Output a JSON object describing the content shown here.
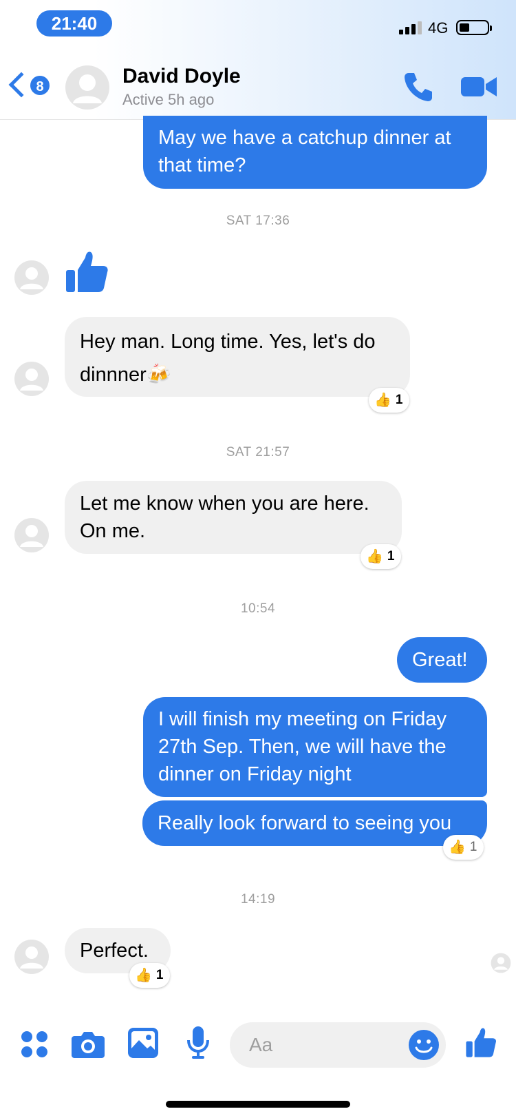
{
  "status_bar": {
    "time": "21:40",
    "network": "4G",
    "battery_percent": 30
  },
  "header": {
    "back_badge": "8",
    "contact_name": "David Doyle",
    "contact_status": "Active 5h ago",
    "icons": [
      "chevron-left-icon",
      "phone-icon",
      "video-camera-icon"
    ]
  },
  "messages": [
    {
      "dir": "out",
      "text": "May we have a catchup dinner at that time?"
    },
    {
      "timestamp": "SAT 17:36"
    },
    {
      "dir": "in",
      "type": "thumbs-up-sticker"
    },
    {
      "dir": "in",
      "text": "Hey man. Long time. Yes, let's do dinnner🍻",
      "reaction": {
        "emoji": "👍",
        "count": "1"
      }
    },
    {
      "timestamp": "SAT 21:57"
    },
    {
      "dir": "in",
      "text": "Let me know when you are here. On me.",
      "reaction": {
        "emoji": "👍",
        "count": "1"
      }
    },
    {
      "timestamp": "10:54"
    },
    {
      "dir": "out",
      "text": "Great!"
    },
    {
      "dir": "out",
      "text": "I will finish my meeting on Friday 27th Sep.  Then, we will have the dinner on Friday night"
    },
    {
      "dir": "out",
      "text": "Really look forward to seeing you",
      "reaction": {
        "emoji": "👍",
        "count": "1"
      }
    },
    {
      "timestamp": "14:19"
    },
    {
      "dir": "in",
      "text": "Perfect.",
      "reaction": {
        "emoji": "👍",
        "count": "1"
      }
    }
  ],
  "composer": {
    "placeholder": "Aa",
    "icons": [
      "apps-icon",
      "camera-icon",
      "image-icon",
      "microphone-icon",
      "emoji-icon",
      "thumbs-up-icon"
    ]
  },
  "colors": {
    "accent": "#2d7ae8",
    "incoming_bubble": "#f0f0f0",
    "timestamp": "#9e9e9e"
  }
}
